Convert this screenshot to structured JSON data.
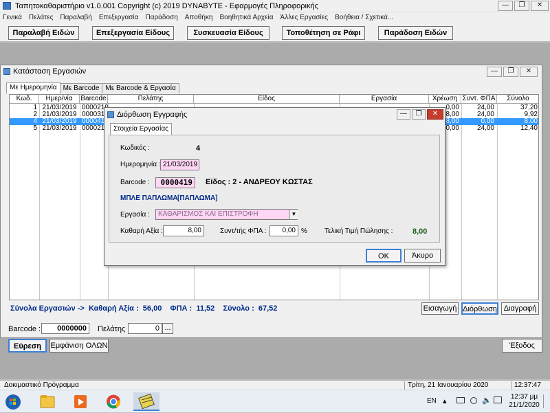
{
  "app": {
    "title": "Ταπητοκαθαριστήριο v1.0.001   Copyright (c) 2019  DYNABYTE - Εφαρμογές Πληροφορικής",
    "window_buttons": {
      "minimize": "—",
      "restore": "❐",
      "close": "✕"
    }
  },
  "menu": [
    "Γενικά",
    "Πελάτες",
    "Παραλαβή",
    "Επεξεργασία",
    "Παράδοση",
    "Αποθήκη",
    "Βοηθητικά Αρχεία",
    "Άλλες Εργασίες",
    "Βοήθεια / Σχετικά..."
  ],
  "toolbar": {
    "receive": "Παραλαβή Ειδών",
    "process": "Επεξεργασία Είδους",
    "package": "Συσκευασία Είδους",
    "shelf": "Τοποθέτηση σε Ράφι",
    "deliver": "Παράδοση Ειδών"
  },
  "child": {
    "title": "Κατάσταση Εργασιών",
    "tabs": [
      "Με Ημερομηνία",
      "Με Barcode",
      "Με Barcode & Εργασία"
    ],
    "columns": [
      "Κωδ.",
      "Ημερ/νία",
      "Barcode",
      "Πελάτης",
      "Είδος",
      "Εργασία",
      "Χρέωση",
      "Συντ. ΦΠΑ",
      "Σύνολο"
    ],
    "rows": [
      {
        "code": "1",
        "date": "21/03/2019",
        "barcode": "0000219",
        "customer": "",
        "item": "",
        "job": "",
        "charge": "0,00",
        "vat": "24,00",
        "total": "37,20"
      },
      {
        "code": "2",
        "date": "21/03/2019",
        "barcode": "0000319",
        "customer": "",
        "item": "",
        "job": "",
        "charge": "8,00",
        "vat": "24,00",
        "total": "9,92"
      },
      {
        "code": "4",
        "date": "21/03/2019",
        "barcode": "000041",
        "customer": "",
        "item": "",
        "job": "",
        "charge": "8,00",
        "vat": "0,00",
        "total": "8,00"
      },
      {
        "code": "5",
        "date": "21/03/2019",
        "barcode": "0000219",
        "customer": "",
        "item": "",
        "job": "",
        "charge": "0,00",
        "vat": "24,00",
        "total": "12,40"
      }
    ],
    "selected_row_index": 2,
    "totals": {
      "label": "Σύνολα Εργασιών ->",
      "net_label": "Καθαρή Αξία :",
      "net": "56,00",
      "vat_label": "ΦΠΑ :",
      "vat": "11,52",
      "total_label": "Σύνολο :",
      "total": "67,52"
    },
    "buttons": {
      "insert": "Εισαγωγή",
      "edit": "Διόρθωση",
      "delete": "Διαγραφή"
    }
  },
  "search": {
    "barcode_label": "Barcode :",
    "barcode_value": "0000000",
    "customer_label": "Πελάτης :",
    "customer_value": "0",
    "browse": "...",
    "find": "Εύρεση",
    "show_all": "Εμφάνιση ΟΛΩΝ",
    "exit": "Έξοδος"
  },
  "statusbar": {
    "left": "Δοκιμαστικό Πρόγραμμα",
    "date": "Τρίτη, 21 Ιανουαρίου 2020",
    "time": "12:37:47"
  },
  "taskbar": {
    "lang": "EN",
    "clock_time": "12:37 μμ",
    "clock_date": "21/1/2020"
  },
  "modal": {
    "title": "Διόρθωση Εγγραφής",
    "tab": "Στοιχεία Εργασίας",
    "code_label": "Κωδικός :",
    "code": "4",
    "date_label": "Ημερομηνία :",
    "date": "21/03/2019",
    "barcode_label": "Barcode :",
    "barcode": "0000419",
    "item_text": "Είδος : 2 - ΑΝΔΡΕΟΥ ΚΩΣΤΑΣ",
    "product": "ΜΠΛΕ ΠΑΠΛΩΜΑ",
    "product_tag": "[ΠΑΠΛΩΜΑ]",
    "job_label": "Εργασία :",
    "job": "ΚΑΘΑΡΙΣΜΟΣ ΚΑΙ ΕΠΙΣΤΡΟΦΗ",
    "net_label": "Καθαρή Αξία :",
    "net": "8,00",
    "vat_label": "Συντ/τής ΦΠΑ :",
    "vat": "0,00",
    "percent": "%",
    "final_label": "Τελική Τιμή Πώλησης :",
    "final": "8,00",
    "ok": "OK",
    "cancel": "Άκυρο"
  },
  "colors": {
    "selection": "#3399ff",
    "pink_field": "#ffd7f5",
    "totals_text": "#002b8a",
    "final_price": "#1b5e20",
    "modal_close": "#c43c2c"
  }
}
